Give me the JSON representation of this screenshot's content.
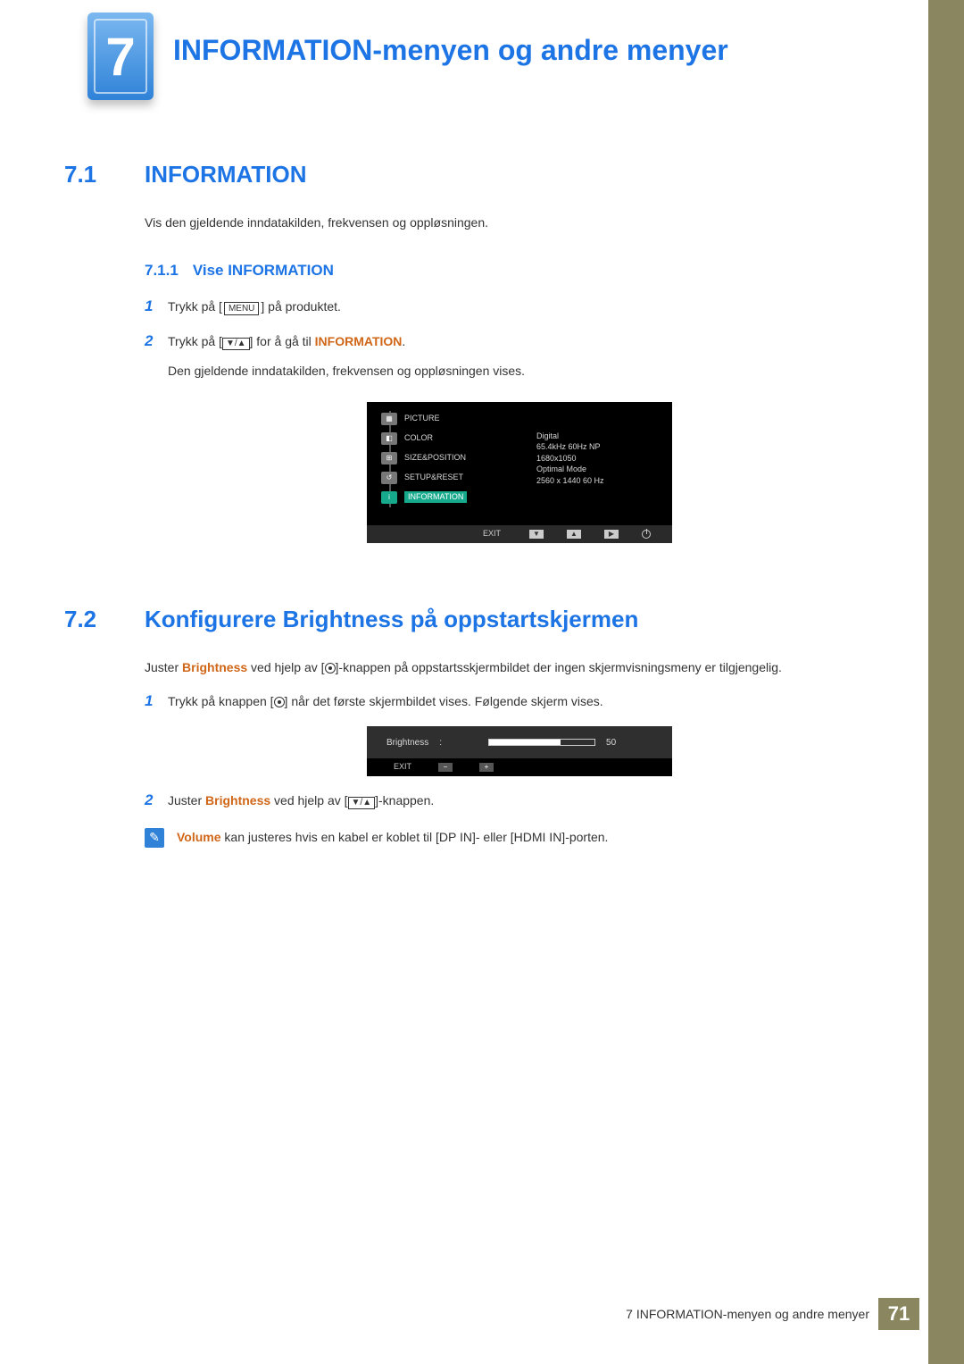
{
  "chapter": {
    "number": "7",
    "title": "INFORMATION-menyen og andre menyer"
  },
  "section1": {
    "num": "7.1",
    "title": "INFORMATION",
    "intro": "Vis den gjeldende inndatakilden, frekvensen og oppløsningen.",
    "sub_num": "7.1.1",
    "sub_title": "Vise INFORMATION",
    "step1_num": "1",
    "step1_a": "Trykk på [",
    "step1_menu": "MENU",
    "step1_b": "] på produktet.",
    "step2_num": "2",
    "step2_a": "Trykk på [",
    "step2_b": "] for å gå til ",
    "step2_c": "INFORMATION",
    "step2_d": ".",
    "step2_line2": "Den gjeldende inndatakilden, frekvensen og oppløsningen vises."
  },
  "osd1": {
    "items": [
      "PICTURE",
      "COLOR",
      "SIZE&POSITION",
      "SETUP&RESET",
      "INFORMATION"
    ],
    "info": [
      "Digital",
      "65.4kHz 60Hz NP",
      "1680x1050",
      "",
      "Optimal Mode",
      "2560 x 1440  60 Hz"
    ],
    "exit": "EXIT"
  },
  "section2": {
    "num": "7.2",
    "title": "Konfigurere Brightness på oppstartskjermen",
    "p_a": "Juster ",
    "p_b": "Brightness",
    "p_c": " ved hjelp av [",
    "p_d": "]-knappen på oppstartsskjermbildet der ingen skjermvisningsmeny er tilgjengelig.",
    "step1_num": "1",
    "step1_a": "Trykk på knappen [",
    "step1_b": "] når det første skjermbildet vises. Følgende skjerm vises.",
    "step2_num": "2",
    "step2_a": "Juster ",
    "step2_b": "Brightness",
    "step2_c": " ved hjelp av [",
    "step2_d": "]-knappen."
  },
  "osd2": {
    "label": "Brightness",
    "colon": ":",
    "value": "50",
    "exit": "EXIT"
  },
  "note": {
    "a": "Volume",
    "b": "  kan justeres hvis en kabel er koblet til [DP IN]- eller [HDMI IN]-porten."
  },
  "footer": {
    "text": "7 INFORMATION-menyen og andre menyer",
    "page": "71"
  }
}
